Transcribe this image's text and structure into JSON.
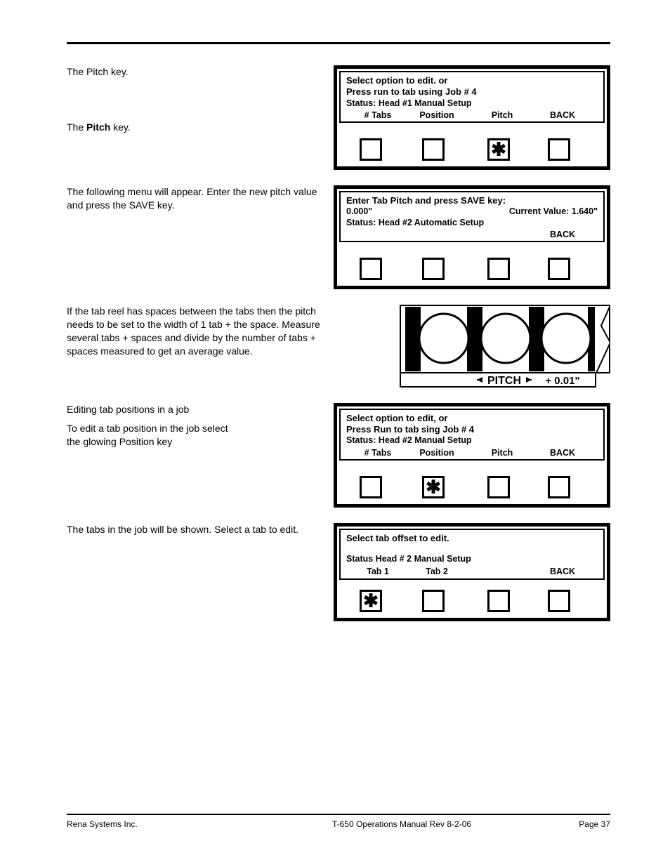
{
  "section_head": {
    "note": "The Pitch key.",
    "prompt": "Pitch"
  },
  "panel1": {
    "line1": "Select option to edit. or",
    "line2": "Press run to tab using Job # 4",
    "status": "Status: Head #1 Manual Setup",
    "opts": {
      "a": "# Tabs",
      "b": "Position",
      "c": "Pitch",
      "d": "BACK"
    }
  },
  "para2": "The following menu will appear. Enter the new pitch value and press the SAVE key.",
  "panel2": {
    "line1": "Enter Tab Pitch and press SAVE key:",
    "val_left": "0.000\"",
    "val_right": "Current Value: 1.640\"",
    "status": "Status: Head #2  Automatic Setup",
    "back": "BACK"
  },
  "para3": "If the tab reel has spaces between the tabs then the pitch needs to be set to the width of 1 tab + the space. Measure several tabs + spaces and divide by the number of tabs + spaces measured to get an average value.",
  "diagram": {
    "pitch_label": "PITCH",
    "offset_label": "+ 0.01\""
  },
  "para4a": "Editing tab positions in a job",
  "para4b": "To edit a tab position in the job select",
  "para4c": "the glowing Position key",
  "panel3": {
    "line1": "Select option to edit, or",
    "line2": "Press Run to tab sing Job # 4",
    "status": "Status: Head #2 Manual Setup",
    "opts": {
      "a": "# Tabs",
      "b": "Position",
      "c": "Pitch",
      "d": "BACK"
    }
  },
  "para5": "The tabs in the job will be shown. Select a tab to edit.",
  "panel4": {
    "line1": "Select tab offset to edit.",
    "status": "Status Head # 2 Manual Setup",
    "opts": {
      "a": "Tab 1",
      "b": "Tab 2",
      "d": "BACK"
    }
  },
  "footer": {
    "left": "Rena Systems Inc.",
    "center": "T-650 Operations Manual Rev 8-2-06",
    "right": "Page 37"
  }
}
